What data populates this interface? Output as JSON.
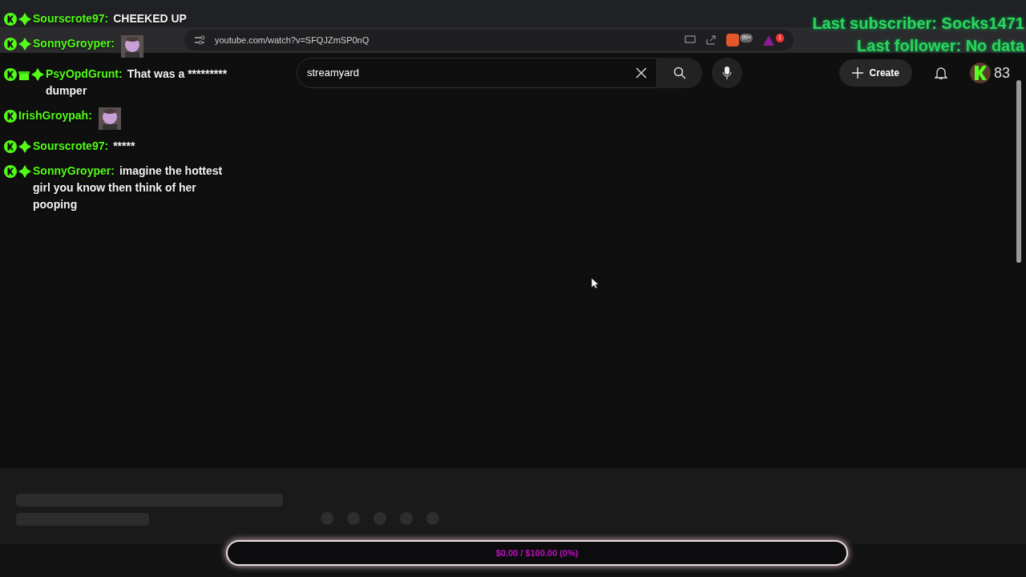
{
  "browser": {
    "url": "youtube.com/watch?v=SFQJZmSP0nQ",
    "extension_badges": [
      "99+",
      "1"
    ]
  },
  "youtube": {
    "search": "streamyard",
    "create_label": "Create",
    "account_count": "83"
  },
  "chat": [
    {
      "user": "Sourscrote97:",
      "badges": [
        {
          "kind": "kick"
        },
        {
          "kind": "sparkle"
        }
      ],
      "kind": "text",
      "message": "CHEEKED UP"
    },
    {
      "user": "SonnyGroyper:",
      "badges": [
        {
          "kind": "kick"
        },
        {
          "kind": "sparkle"
        }
      ],
      "kind": "emote"
    },
    {
      "user": "PsyOpdGrunt:",
      "badges": [
        {
          "kind": "kick"
        },
        {
          "kind": "gift"
        },
        {
          "kind": "sparkle"
        }
      ],
      "kind": "text",
      "message": "That was a ********* dumper"
    },
    {
      "user": "IrishGroypah:",
      "badges": [
        {
          "kind": "kick"
        }
      ],
      "kind": "emote"
    },
    {
      "user": "Sourscrote97:",
      "badges": [
        {
          "kind": "kick"
        },
        {
          "kind": "sparkle"
        }
      ],
      "kind": "text",
      "message": "*****"
    },
    {
      "user": "SonnyGroyper:",
      "badges": [
        {
          "kind": "kick"
        },
        {
          "kind": "sparkle"
        }
      ],
      "kind": "text",
      "message": "imagine the hottest girl you know then think of her pooping"
    }
  ],
  "overlay": {
    "last_subscriber": "Last subscriber: Socks1471",
    "last_follower": "Last follower: No data"
  },
  "goal": {
    "text": "$0.00 / $100.00 (0%)",
    "level": 0
  }
}
